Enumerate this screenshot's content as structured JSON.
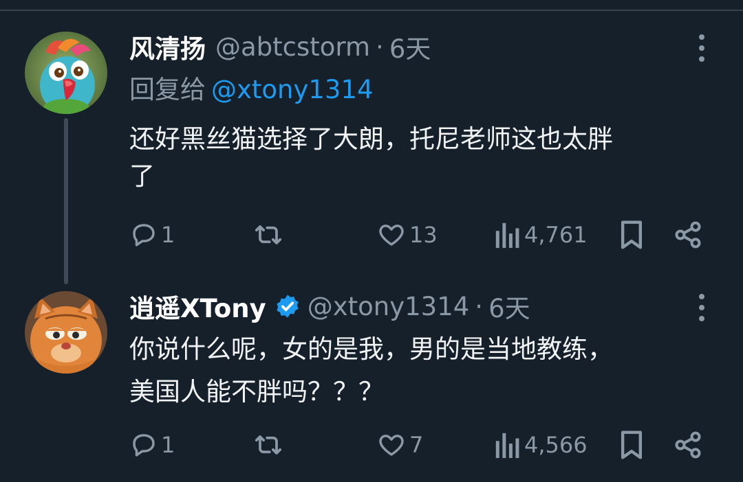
{
  "tweets": [
    {
      "name": "风清扬",
      "handle": "@abtcstorm",
      "dot": "·",
      "time": "6天",
      "reply_prefix": "回复给",
      "reply_mention": "@xtony1314",
      "body_line1": "还好黑丝猫选择了大朗，托尼老师这也太胖",
      "body_line2": "了",
      "reply_count": "1",
      "retweet_count": "",
      "like_count": "13",
      "view_count": "4,761",
      "avatar_icon": "parrot-avatar"
    },
    {
      "name": "逍遥XTony",
      "verified": true,
      "handle": "@xtony1314",
      "dot": "·",
      "time": "6天",
      "body_line1": "你说什么呢，女的是我，男的是当地教练，",
      "body_line2": "美国人能不胖吗？？？",
      "reply_count": "1",
      "retweet_count": "",
      "like_count": "7",
      "view_count": "4,566",
      "avatar_icon": "cat-avatar"
    }
  ],
  "colors": {
    "background": "#15202b",
    "text": "#f1f3f5",
    "muted": "#8b98a5",
    "accent": "#1d9bf0"
  },
  "icons": {
    "reply": "speech-bubble-icon",
    "retweet": "retweet-arrows-icon",
    "like": "heart-icon",
    "views": "bar-chart-icon",
    "bookmark": "bookmark-icon",
    "share": "share-icon",
    "more": "more-vertical-icon",
    "verified": "verified-badge-icon"
  }
}
